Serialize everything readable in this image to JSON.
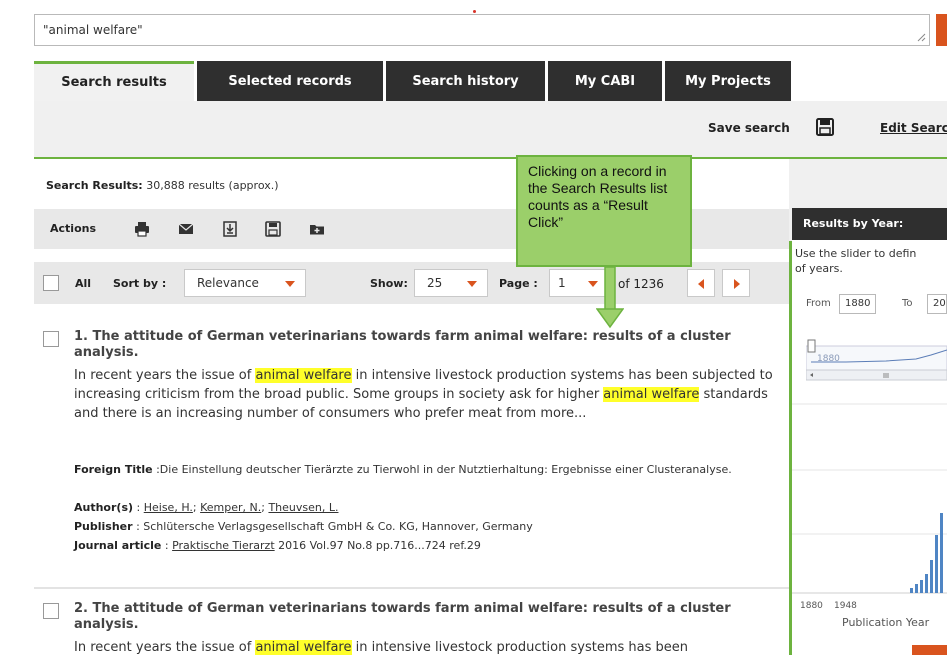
{
  "search": {
    "query": "\"animal welfare\""
  },
  "tabs": [
    {
      "label": "Search results"
    },
    {
      "label": "Selected records"
    },
    {
      "label": "Search history"
    },
    {
      "label": "My CABI"
    },
    {
      "label": "My Projects"
    }
  ],
  "toolbar": {
    "save_label": "Save search",
    "edit_label": "Edit Searc"
  },
  "results": {
    "count_label": "Search Results:",
    "count_text": "30,888 results (approx.)",
    "actions_label": "Actions",
    "all_label": "All",
    "sort_label": "Sort by :",
    "sort_value": "Relevance",
    "show_label": "Show:",
    "show_value": "25",
    "page_label": "Page :",
    "page_value": "1",
    "of_pages": "of 1236"
  },
  "callout": {
    "text": "Clicking on a record in the Search Results list counts as a “Result Click”"
  },
  "records": [
    {
      "title": "1. The attitude of German veterinarians towards farm animal welfare: results of a cluster analysis.",
      "abstract_1": "In recent years the issue of ",
      "hl_1": "animal welfare",
      "abstract_2": " in intensive livestock production systems has been subjected to increasing criticism from the broad public. Some groups in society ask for higher ",
      "hl_2": "animal welfare",
      "abstract_3": " standards and there is an increasing number of consumers who prefer meat from more...",
      "foreign_label": "Foreign Title",
      "foreign_title": " :Die Einstellung deutscher Tierärzte zu Tierwohl in der Nutztierhaltung: Ergebnisse einer Clusteranalyse.",
      "authors_label": "Author(s)",
      "author_1": "Heise, H.",
      "author_2": "Kemper, N.",
      "author_3": "Theuvsen, L.",
      "publisher_label": "Publisher",
      "publisher": " : Schlütersche Verlagsgesellschaft GmbH & Co. KG, Hannover, Germany",
      "journal_label": "Journal article",
      "journal_name": "Praktische Tierarzt",
      "journal_details": " 2016 Vol.97 No.8 pp.716...724 ref.29"
    },
    {
      "title": "2. The attitude of German veterinarians towards farm animal welfare: results of a cluster analysis.",
      "abstract_1": "In recent years the issue of ",
      "hl_1": "animal welfare",
      "abstract_2": " in intensive livestock production systems has been"
    }
  ],
  "sidebar": {
    "title": "Results by Year:",
    "hint_1": "Use the slider to defin",
    "hint_2": "of years.",
    "from_label": "From",
    "from_value": "1880",
    "to_label": "To",
    "to_value": "20",
    "slider_label": "1880",
    "axis_1880": "1880",
    "axis_1948": "1948",
    "axis_title": "Publication Year"
  },
  "colors": {
    "accent_green": "#6db33f",
    "accent_orange": "#d9541e",
    "tab_dark": "#2f2f2f",
    "highlight": "#ffff2a"
  }
}
